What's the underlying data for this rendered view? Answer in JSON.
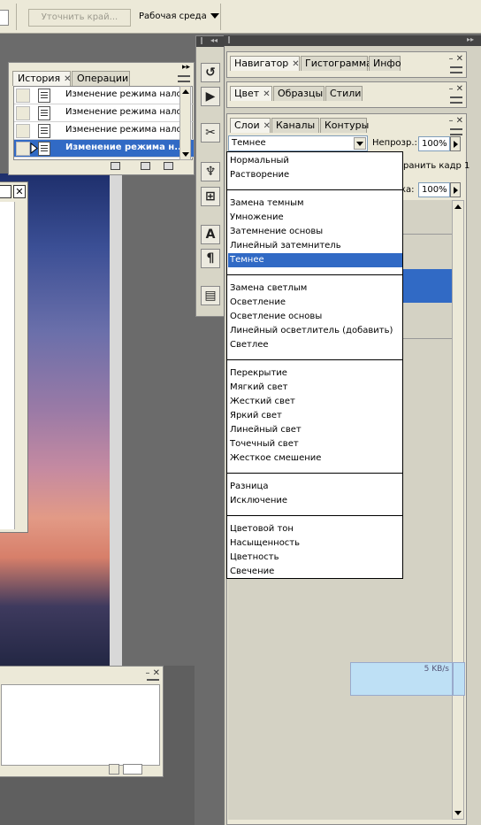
{
  "options_bar": {
    "refine_edge_label": "Уточнить край...",
    "workspace_label": "Рабочая среда"
  },
  "history_panel": {
    "tabs": [
      "История",
      "Операции"
    ],
    "rows": [
      {
        "label": "Изменение режима нало...",
        "selected": false
      },
      {
        "label": "Изменение режима нало...",
        "selected": false
      },
      {
        "label": "Изменение режима нало...",
        "selected": false
      },
      {
        "label": "Изменение режима н...",
        "selected": true
      }
    ]
  },
  "navigator_panel": {
    "tabs": [
      "Навигатор",
      "Гистограмма",
      "Инфо"
    ]
  },
  "color_panel": {
    "tabs": [
      "Цвет",
      "Образцы",
      "Стили"
    ]
  },
  "layers_panel": {
    "tabs": [
      "Слои",
      "Каналы",
      "Контуры"
    ],
    "blend_mode_value": "Темнее",
    "opacity_label": "Непрозр.:",
    "opacity_value": "100%",
    "frame_label": "ранить кадр 1",
    "fill_label": "ка:",
    "fill_value": "100%"
  },
  "blend_menu": {
    "groups": [
      [
        "Нормальный",
        "Растворение"
      ],
      [
        "Замена темным",
        "Умножение",
        "Затемнение основы",
        "Линейный затемнитель",
        "Темнее"
      ],
      [
        "Замена светлым",
        "Осветление",
        "Осветление основы",
        "Линейный осветлитель (добавить)",
        "Светлее"
      ],
      [
        "Перекрытие",
        "Мягкий свет",
        "Жесткий свет",
        "Яркий свет",
        "Линейный свет",
        "Точечный свет",
        "Жесткое смешение"
      ],
      [
        "Разница",
        "Исключение"
      ],
      [
        "Цветовой тон",
        "Насыщенность",
        "Цветность",
        "Свечение"
      ]
    ],
    "selected": "Темнее"
  },
  "network_widget": {
    "speed": "5 KB/s"
  },
  "colors": {
    "selection": "#316ac5",
    "panel_bg": "#ece9d8"
  }
}
